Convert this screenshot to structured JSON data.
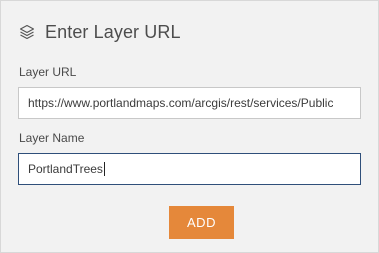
{
  "header": {
    "title": "Enter Layer URL",
    "icon": "layers-icon"
  },
  "form": {
    "url_label": "Layer URL",
    "url_value": "https://www.portlandmaps.com/arcgis/rest/services/Public",
    "name_label": "Layer Name",
    "name_value": "PortlandTrees",
    "add_label": "ADD"
  },
  "colors": {
    "panel_bg": "#f2f2f2",
    "accent": "#e5883a",
    "focused_border": "#2f4f7a"
  }
}
